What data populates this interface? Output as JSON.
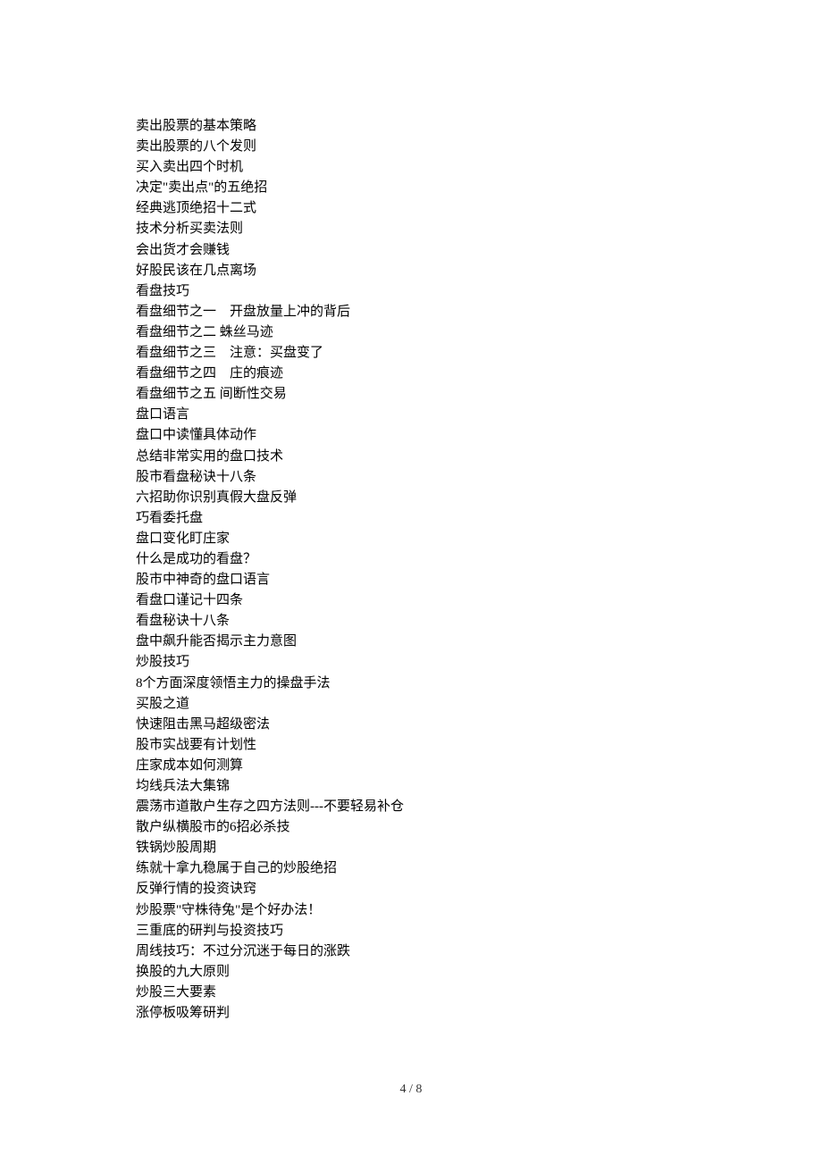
{
  "lines": [
    "卖出股票的基本策略",
    "卖出股票的八个发则",
    "买入卖出四个时机",
    "决定\"卖出点\"的五绝招",
    "经典逃顶绝招十二式",
    "技术分析买卖法则",
    "会出货才会赚钱",
    "好股民该在几点离场",
    "看盘技巧",
    "看盘细节之一    开盘放量上冲的背后",
    "看盘细节之二 蛛丝马迹",
    "看盘细节之三    注意：买盘变了",
    "看盘细节之四    庄的痕迹",
    "看盘细节之五 间断性交易",
    "盘口语言",
    "盘口中读懂具体动作",
    "总结非常实用的盘口技术",
    "股市看盘秘诀十八条",
    "六招助你识别真假大盘反弹",
    "巧看委托盘",
    "盘口变化盯庄家",
    "什么是成功的看盘？",
    "股市中神奇的盘口语言",
    "看盘口谨记十四条",
    "看盘秘诀十八条",
    "盘中飙升能否揭示主力意图",
    "炒股技巧",
    "8个方面深度领悟主力的操盘手法",
    "买股之道",
    "快速阻击黑马超级密法",
    "股市实战要有计划性",
    "庄家成本如何测算",
    "均线兵法大集锦",
    "震荡市道散户生存之四方法则---不要轻易补仓",
    "散户纵横股市的6招必杀技",
    "铁锅炒股周期",
    "练就十拿九稳属于自己的炒股绝招",
    "反弹行情的投资诀窍",
    "炒股票\"守株待兔\"是个好办法！",
    "三重底的研判与投资技巧",
    "周线技巧：不过分沉迷于每日的涨跌",
    "换股的九大原则",
    "炒股三大要素",
    "涨停板吸筹研判"
  ],
  "page_number": "4 / 8"
}
